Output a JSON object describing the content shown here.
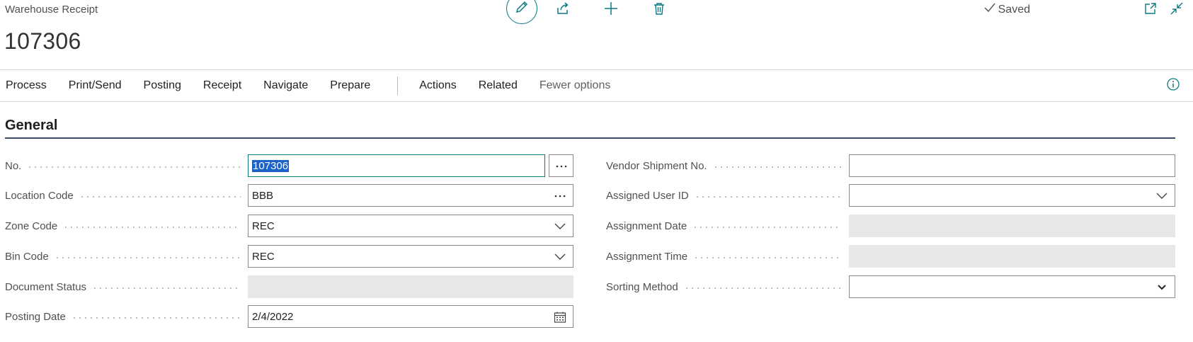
{
  "header": {
    "entity_type": "Warehouse Receipt",
    "record_no": "107306",
    "saved_label": "Saved",
    "icons": [
      "pencil-icon",
      "share-icon",
      "plus-icon",
      "trash-icon",
      "checkmark-icon",
      "open-new-window-icon",
      "collapse-icon"
    ]
  },
  "action_bar": {
    "items": [
      "Process",
      "Print/Send",
      "Posting",
      "Receipt",
      "Navigate",
      "Prepare"
    ],
    "secondary": [
      "Actions",
      "Related"
    ],
    "fewer_options": "Fewer options",
    "info_icon": "info-icon"
  },
  "section": {
    "title": "General"
  },
  "left_fields": [
    {
      "label": "No.",
      "value": "107306"
    },
    {
      "label": "Location Code",
      "value": "BBB"
    },
    {
      "label": "Zone Code",
      "value": "REC"
    },
    {
      "label": "Bin Code",
      "value": "REC"
    },
    {
      "label": "Document Status",
      "value": ""
    },
    {
      "label": "Posting Date",
      "value": "2/4/2022"
    }
  ],
  "right_fields": [
    {
      "label": "Vendor Shipment No.",
      "value": ""
    },
    {
      "label": "Assigned User ID",
      "value": ""
    },
    {
      "label": "Assignment Date",
      "value": ""
    },
    {
      "label": "Assignment Time",
      "value": ""
    },
    {
      "label": "Sorting Method",
      "value": ""
    }
  ],
  "colors": {
    "accent": "#0b7a80",
    "selection": "#1c63c9",
    "readonly_bg": "#e6e7e8"
  }
}
